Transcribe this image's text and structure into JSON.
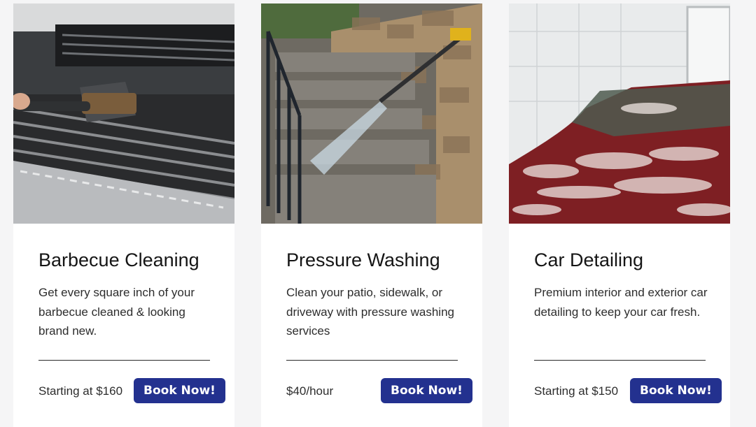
{
  "services": [
    {
      "title": "Barbecue Cleaning",
      "description": "Get every square inch of your barbecue cleaned & looking brand new.",
      "price": "Starting at $160",
      "button_label": "Book Now!"
    },
    {
      "title": "Pressure Washing",
      "description": "Clean your patio, sidewalk, or driveway with pressure washing services",
      "price": "$40/hour",
      "button_label": "Book Now!"
    },
    {
      "title": "Car Detailing",
      "description": "Premium interior and exterior car detailing to keep your car fresh.",
      "price": "Starting at $150",
      "button_label": "Book Now!"
    }
  ],
  "colors": {
    "page_background": "#f5f5f6",
    "card_background": "#ffffff",
    "button_background": "#23318f",
    "button_text": "#ffffff",
    "title_text": "#151515",
    "body_text": "#2d2d2d"
  }
}
